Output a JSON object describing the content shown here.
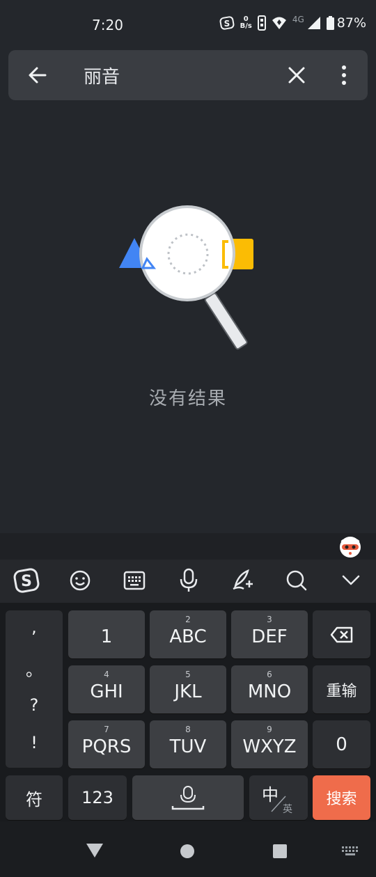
{
  "status_bar": {
    "time": "7:20",
    "speed_top": "0",
    "speed_unit": "B/s",
    "network": "4G",
    "battery": "87%"
  },
  "search": {
    "query": "丽音"
  },
  "empty_state": {
    "message": "没有结果"
  },
  "keyboard": {
    "punctuation": [
      ",",
      "。",
      "?",
      "!"
    ],
    "keys": [
      {
        "num": "",
        "label": "1"
      },
      {
        "num": "2",
        "label": "ABC"
      },
      {
        "num": "3",
        "label": "DEF"
      },
      {
        "num": "4",
        "label": "GHI"
      },
      {
        "num": "5",
        "label": "JKL"
      },
      {
        "num": "6",
        "label": "MNO"
      },
      {
        "num": "7",
        "label": "PQRS"
      },
      {
        "num": "8",
        "label": "TUV"
      },
      {
        "num": "9",
        "label": "WXYZ"
      }
    ],
    "reinput": "重输",
    "zero": "0",
    "symbols": "符",
    "numbers": "123",
    "lang_main": "中",
    "lang_alt": "英",
    "search_label": "搜索"
  },
  "colors": {
    "background": "#24272c",
    "search_key": "#ef6c4b",
    "accent_blue": "#4285f4",
    "accent_yellow": "#fbbc04"
  }
}
